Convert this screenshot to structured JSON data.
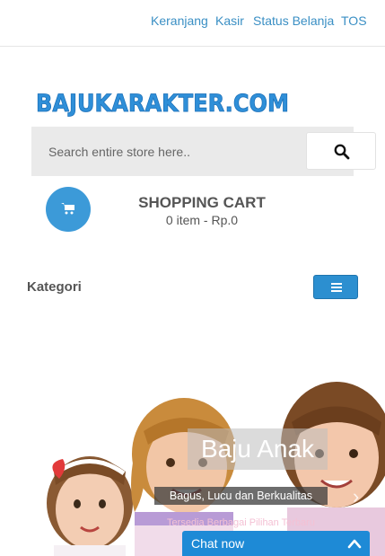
{
  "topnav": {
    "links": [
      "Keranjang",
      "Kasir",
      "Status Belanja",
      "TOS"
    ]
  },
  "logo": {
    "text": "BAJUKARAKTER.COM"
  },
  "search": {
    "placeholder": "Search entire store here.."
  },
  "cart": {
    "title": "SHOPPING CART",
    "info": "0 item - Rp.0"
  },
  "category": {
    "label": "Kategori"
  },
  "slider": {
    "title": "Baju Anak",
    "subtitle": "Bagus, Lucu dan Berkualitas",
    "caption": "Tersedia Berbagai Pilihan Terbaru",
    "prev": "‹",
    "next": "›"
  },
  "chat": {
    "label": "Chat now"
  },
  "colors": {
    "accent": "#3a8fc4",
    "brand": "#3c9ad8",
    "chat": "#1e8ad6"
  }
}
